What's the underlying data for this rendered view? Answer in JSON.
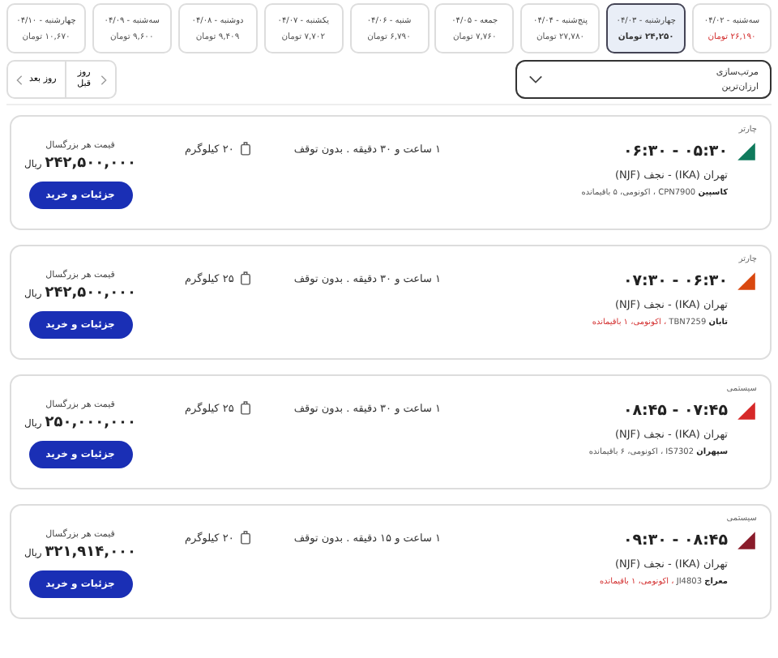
{
  "dates": [
    {
      "day": "سه‌شنبه - ۰۴/۰۲",
      "price": "۲۶,۱۹۰ تومان",
      "color": "#d32f2f",
      "selected": false
    },
    {
      "day": "چهارشنبه - ۰۴/۰۳",
      "price": "۲۴,۲۵۰ تومان",
      "color": "#333333",
      "selected": true
    },
    {
      "day": "پنج‌شنبه - ۰۴/۰۴",
      "price": "۲۷,۷۸۰ تومان",
      "color": "#555555",
      "selected": false
    },
    {
      "day": "جمعه - ۰۴/۰۵",
      "price": "۷,۷۶۰ تومان",
      "color": "#555555",
      "selected": false
    },
    {
      "day": "شنبه - ۰۴/۰۶",
      "price": "۶,۷۹۰ تومان",
      "color": "#555555",
      "selected": false
    },
    {
      "day": "یکشنبه - ۰۴/۰۷",
      "price": "۷,۷۰۲ تومان",
      "color": "#555555",
      "selected": false
    },
    {
      "day": "دوشنبه - ۰۴/۰۸",
      "price": "۹,۴۰۹ تومان",
      "color": "#555555",
      "selected": false
    },
    {
      "day": "سه‌شنبه - ۰۴/۰۹",
      "price": "۹,۶۰۰ تومان",
      "color": "#555555",
      "selected": false
    },
    {
      "day": "چهارشنبه - ۰۴/۱۰",
      "price": "۱۰,۶۷۰ تومان",
      "color": "#555555",
      "selected": false
    }
  ],
  "sort": {
    "label": "مرتب‌سازی",
    "value": "ارزان‌ترین"
  },
  "day_nav": {
    "previous": "روز قبل",
    "next": "روز بعد"
  },
  "flights": [
    {
      "type": "چارتر",
      "color": "#0f7a5c",
      "times": "۰۵:۳۰ - ۰۶:۳۰",
      "route": "تهران (IKA) - نجف (NJF)",
      "airline": "کاسپین",
      "flight_no": "CPN7900",
      "details": "، اکونومی، ۵ باقیمانده",
      "low_seats": false,
      "duration": "۱ ساعت و ۳۰ دقیقه . بدون توقف",
      "baggage": "۲۰ کیلوگرم",
      "price_label": "قیمت هر بزرگسال",
      "price": "۲۴۲,۵۰۰,۰۰۰",
      "currency": "ریال",
      "button": "جزئیات و خرید"
    },
    {
      "type": "چارتر",
      "color": "#d9480f",
      "times": "۰۶:۳۰ - ۰۷:۳۰",
      "route": "تهران (IKA) - نجف (NJF)",
      "airline": "تابان",
      "flight_no": "TBN7259",
      "details": "، اکونومی، ۱ باقیمانده",
      "low_seats": true,
      "duration": "۱ ساعت و ۳۰ دقیقه . بدون توقف",
      "baggage": "۲۵ کیلوگرم",
      "price_label": "قیمت هر بزرگسال",
      "price": "۲۴۲,۵۰۰,۰۰۰",
      "currency": "ریال",
      "button": "جزئیات و خرید"
    },
    {
      "type": "سیستمی",
      "color": "#d62828",
      "times": "۰۷:۴۵ - ۰۸:۴۵",
      "route": "تهران (IKA) - نجف (NJF)",
      "airline": "سپهران",
      "flight_no": "IS7302",
      "details": "، اکونومی، ۶ باقیمانده",
      "low_seats": false,
      "duration": "۱ ساعت و ۳۰ دقیقه . بدون توقف",
      "baggage": "۲۵ کیلوگرم",
      "price_label": "قیمت هر بزرگسال",
      "price": "۲۵۰,۰۰۰,۰۰۰",
      "currency": "ریال",
      "button": "جزئیات و خرید"
    },
    {
      "type": "سیستمی",
      "color": "#8a1c2b",
      "times": "۰۸:۴۵ - ۰۹:۳۰",
      "route": "تهران (IKA) - نجف (NJF)",
      "airline": "معراج",
      "flight_no": "JI4803",
      "details": "، اکونومی، ۱ باقیمانده",
      "low_seats": true,
      "duration": "۱ ساعت و ۱۵ دقیقه . بدون توقف",
      "baggage": "۲۰ کیلوگرم",
      "price_label": "قیمت هر بزرگسال",
      "price": "۳۲۱,۹۱۴,۰۰۰",
      "currency": "ریال",
      "button": "جزئیات و خرید"
    }
  ]
}
